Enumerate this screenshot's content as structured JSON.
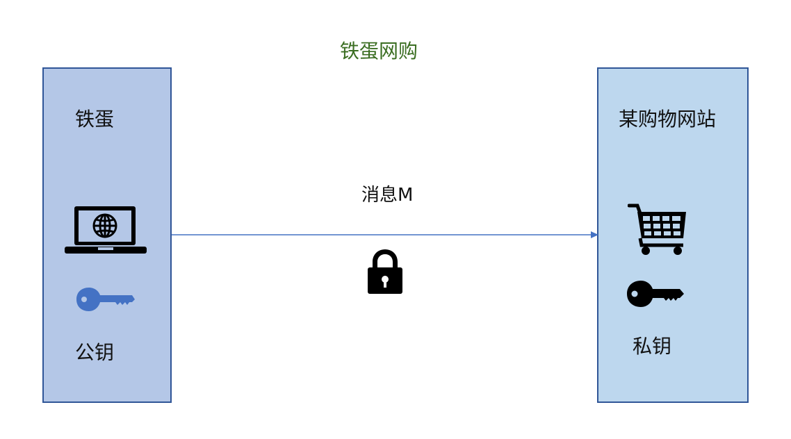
{
  "title": "铁蛋网购",
  "left_party": {
    "name": "铁蛋",
    "key_label": "公钥",
    "icons": [
      "laptop-globe-icon",
      "key-icon"
    ],
    "key_color": "#4472c4"
  },
  "right_party": {
    "name": "某购物网站",
    "key_label": "私钥",
    "icons": [
      "shopping-cart-icon",
      "key-icon"
    ],
    "key_color": "#000000"
  },
  "message": {
    "label": "消息M",
    "icon": "padlock-icon"
  },
  "colors": {
    "title": "#3b6e22",
    "left_panel_fill": "#b4c7e7",
    "right_panel_fill": "#bdd7ee",
    "panel_border": "#2f5597",
    "arrow": "#4472c4"
  }
}
